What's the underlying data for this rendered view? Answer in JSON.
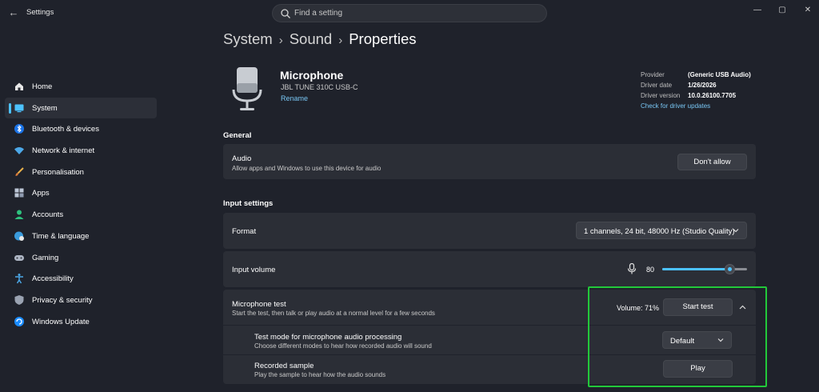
{
  "window": {
    "title": "Settings",
    "back": "←",
    "minimize": "—",
    "maximize": "▢",
    "close": "✕"
  },
  "search": {
    "placeholder": "Find a setting"
  },
  "sidebar": {
    "items": [
      {
        "label": "Home",
        "icon": "home-icon"
      },
      {
        "label": "System",
        "icon": "system-icon",
        "active": true
      },
      {
        "label": "Bluetooth & devices",
        "icon": "bluetooth-icon"
      },
      {
        "label": "Network & internet",
        "icon": "wifi-icon"
      },
      {
        "label": "Personalisation",
        "icon": "brush-icon"
      },
      {
        "label": "Apps",
        "icon": "apps-icon"
      },
      {
        "label": "Accounts",
        "icon": "accounts-icon"
      },
      {
        "label": "Time & language",
        "icon": "globe-clock-icon"
      },
      {
        "label": "Gaming",
        "icon": "gamepad-icon"
      },
      {
        "label": "Accessibility",
        "icon": "accessibility-icon"
      },
      {
        "label": "Privacy & security",
        "icon": "shield-icon"
      },
      {
        "label": "Windows Update",
        "icon": "update-icon"
      }
    ]
  },
  "breadcrumb": {
    "items": [
      "System",
      "Sound",
      "Properties"
    ],
    "separator": "›"
  },
  "device": {
    "name": "Microphone",
    "model": "JBL TUNE 310C USB-C",
    "rename": "Rename",
    "provider_label": "Provider",
    "provider": "(Generic USB Audio)",
    "date_label": "Driver date",
    "date": "1/26/2026",
    "version_label": "Driver version",
    "version": "10.0.26100.7705",
    "update_link": "Check for driver updates"
  },
  "general": {
    "heading": "General",
    "audio_title": "Audio",
    "audio_sub": "Allow apps and Windows to use this device for audio",
    "audio_button": "Don't allow"
  },
  "input": {
    "heading": "Input settings",
    "format_title": "Format",
    "format_value": "1 channels, 24 bit, 48000 Hz (Studio Quality)",
    "volume_title": "Input volume",
    "volume_value": "80",
    "volume_level": 80,
    "test_title": "Microphone test",
    "test_sub": "Start the test, then talk or play audio at a normal level for a few seconds",
    "test_volume": "Volume: 71%",
    "test_button": "Start test",
    "mode_title": "Test mode for microphone audio processing",
    "mode_sub": "Choose different modes to hear how recorded audio will sound",
    "mode_value": "Default",
    "sample_title": "Recorded sample",
    "sample_sub": "Play the sample to hear how the audio sounds",
    "sample_button": "Play"
  },
  "colors": {
    "accent": "#4cc2ff",
    "highlight": "#22c93a",
    "background": "#1f222b",
    "card": "#2b2e36"
  }
}
